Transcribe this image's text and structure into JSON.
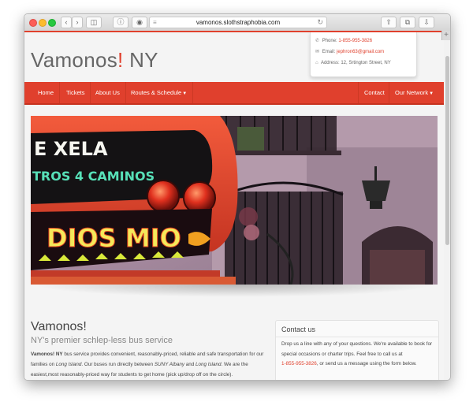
{
  "browser": {
    "url": "vamonos.slothstraphobia.com",
    "reload_icon": "reload-icon",
    "back_icon": "back-icon",
    "forward_icon": "forward-icon"
  },
  "header": {
    "title_main": "Vamonos",
    "title_bang": "!",
    "title_suffix": " NY",
    "contact": {
      "phone_label": "Phone:",
      "phone": "1-855-955-3826",
      "email_label": "Email:",
      "email": "jephron63@gmail.com",
      "address_label": "Address:",
      "address": "12, Srtington Street, NY"
    }
  },
  "nav": {
    "items": [
      "Home",
      "Tickets",
      "About Us",
      "Routes & Schedule"
    ],
    "right_items": [
      "Contact",
      "Our Network"
    ]
  },
  "main": {
    "heading": "Vamonos!",
    "subheading": "NY's premier schlep-less bus service",
    "para_brand": "Vamonos! NY",
    "para_1": " bus service provides convenient, reasonably-priced, reliable and safe transportation for our families on ",
    "para_li1": "Long Island",
    "para_2": ". Our buses run directly between ",
    "para_suny": "SUNY Albany",
    "para_3": " and ",
    "para_li2": "Long Island",
    "para_4": ". We are the easiest,most reasonably-priced way for students to get home (pick up/drop off on the circle)."
  },
  "contact_box": {
    "title": "Contact us",
    "text_1": "Drop us a line with any of your questions. We're available to book for special occasions or charter trips. Feel free to call us at",
    "phone": "1-855-955-3826",
    "text_2": ", or send us a message using the form below."
  },
  "hero": {
    "sign_top": "E XELA",
    "sign_mid": "TROS 4 CAMINOS",
    "sign_bottom": "DIOS MIO"
  },
  "colors": {
    "accent": "#e0402d",
    "nav_bg": "#e0402d",
    "text": "#333333"
  }
}
